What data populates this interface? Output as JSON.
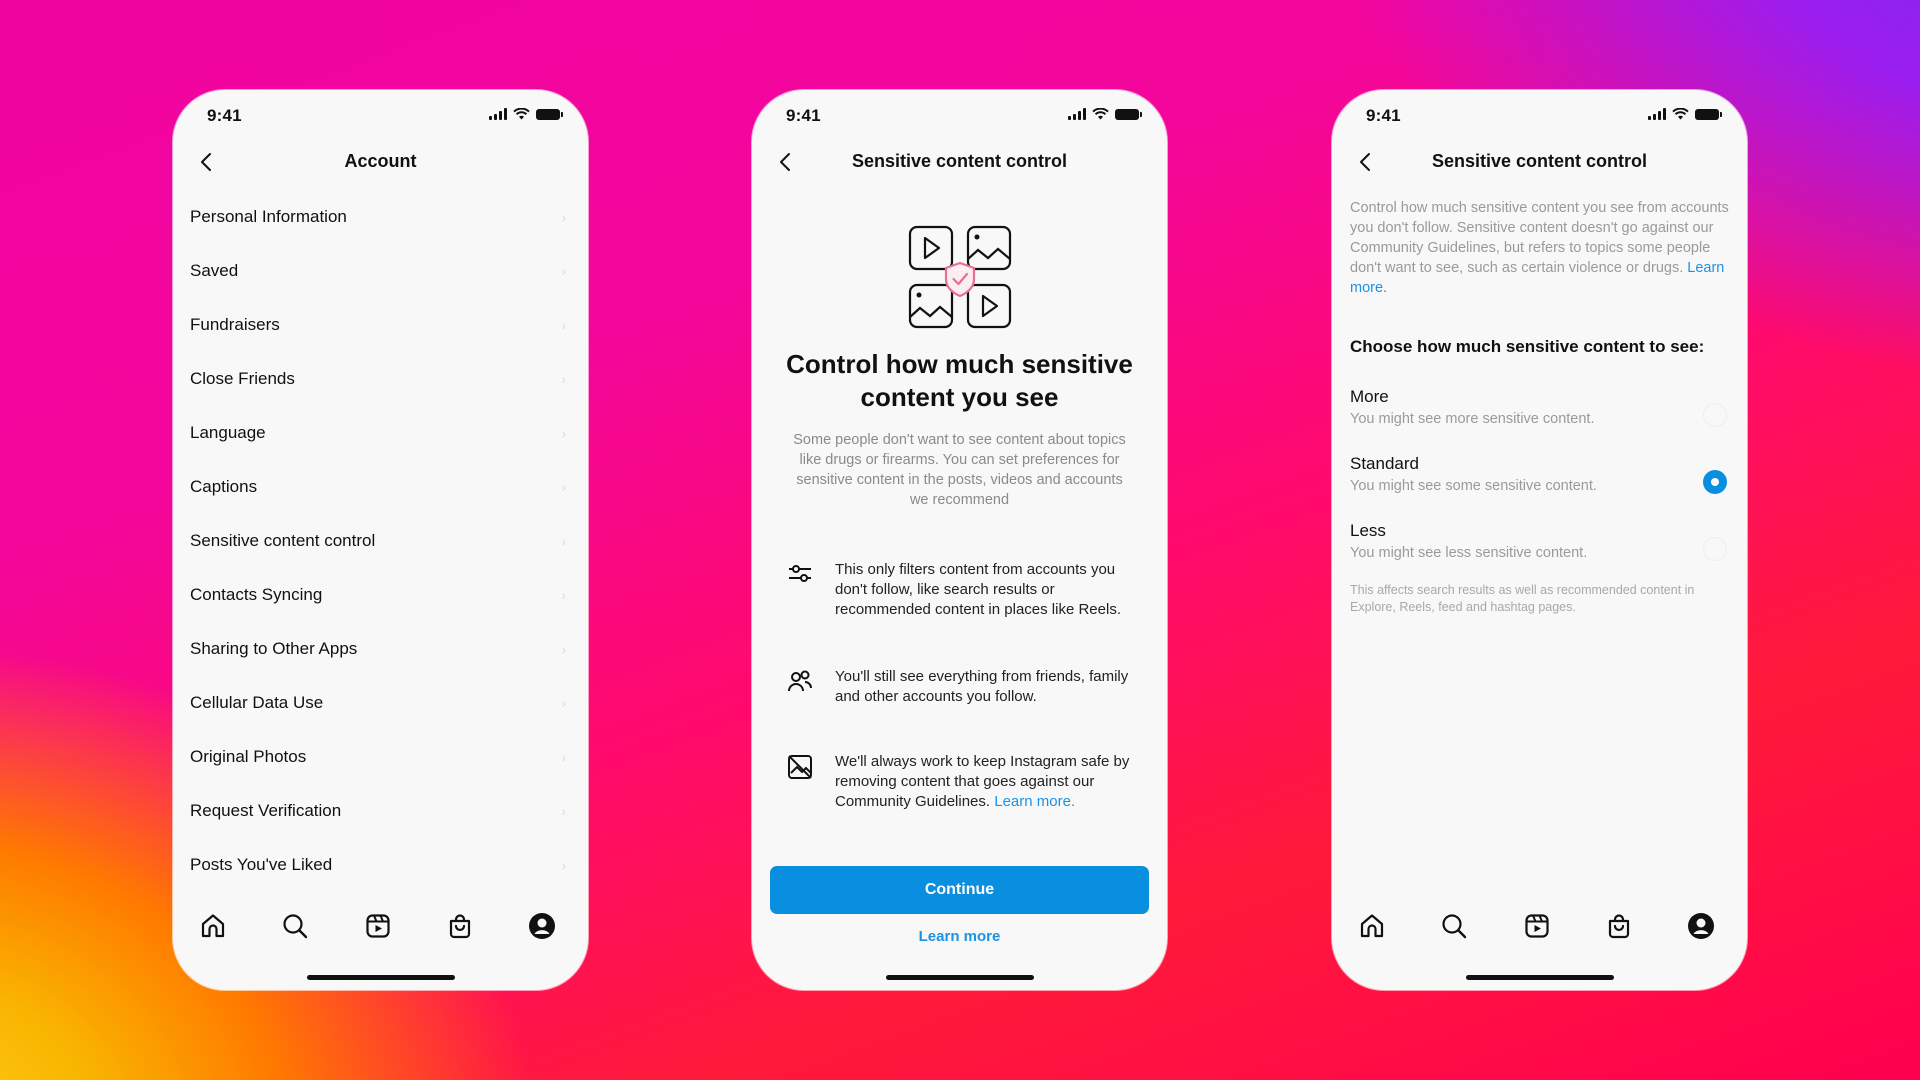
{
  "colors": {
    "accent": "#0A8FE0",
    "link": "#1A93E6",
    "text_primary": "#111111",
    "text_secondary": "#8A8A8A",
    "phone_bg": "#F8F8F8"
  },
  "status_bar": {
    "time": "9:41"
  },
  "phones": [
    {
      "header": {
        "title": "Account",
        "back_icon": "chevron-left-icon"
      },
      "settings_items": [
        {
          "label": "Personal Information"
        },
        {
          "label": "Saved"
        },
        {
          "label": "Fundraisers"
        },
        {
          "label": "Close Friends"
        },
        {
          "label": "Language"
        },
        {
          "label": "Captions"
        },
        {
          "label": "Sensitive content control"
        },
        {
          "label": "Contacts Syncing"
        },
        {
          "label": "Sharing to Other Apps"
        },
        {
          "label": "Cellular Data Use"
        },
        {
          "label": "Original Photos"
        },
        {
          "label": "Request Verification"
        },
        {
          "label": "Posts You've Liked"
        }
      ],
      "chevron": "›",
      "tab_bar": [
        "home-icon",
        "search-icon",
        "reels-icon",
        "shop-icon",
        "profile-icon"
      ]
    },
    {
      "header": {
        "title": "Sensitive content control",
        "back_icon": "chevron-left-icon"
      },
      "hero_icon": "media-shield-icon",
      "hero_title": "Control how much sensitive content you see",
      "hero_description": "Some people don't want to see content about topics like drugs or firearms. You can set preferences for sensitive content in the posts, videos and accounts we recommend",
      "info_rows": [
        {
          "icon": "sliders-icon",
          "text": "This only filters content from accounts you don't follow, like search results or recommended content in places like Reels.",
          "link": ""
        },
        {
          "icon": "people-icon",
          "text": "You'll still see everything from friends, family and other accounts you follow.",
          "link": ""
        },
        {
          "icon": "image-slash-icon",
          "text": "We'll always work to keep Instagram safe by removing content that goes against our Community Guidelines. ",
          "link": "Learn more."
        }
      ],
      "continue_label": "Continue",
      "learn_more_label": "Learn more"
    },
    {
      "header": {
        "title": "Sensitive content control",
        "back_icon": "chevron-left-icon"
      },
      "intro_text": "Control how much sensitive content you see from accounts you don't follow. Sensitive content doesn't go against our Community Guidelines, but refers to topics some people don't want to see, such as certain violence or drugs. ",
      "intro_link": "Learn more.",
      "choose_title": "Choose how much sensitive content to see:",
      "options": [
        {
          "label": "More",
          "description": "You might see more sensitive content.",
          "selected": false
        },
        {
          "label": "Standard",
          "description": "You might see some sensitive content.",
          "selected": true
        },
        {
          "label": "Less",
          "description": "You might see less sensitive content.",
          "selected": false
        }
      ],
      "footnote": "This affects search results as well as recommended content in Explore, Reels, feed and hashtag pages.",
      "tab_bar": [
        "home-icon",
        "search-icon",
        "reels-icon",
        "shop-icon",
        "profile-icon"
      ]
    }
  ]
}
